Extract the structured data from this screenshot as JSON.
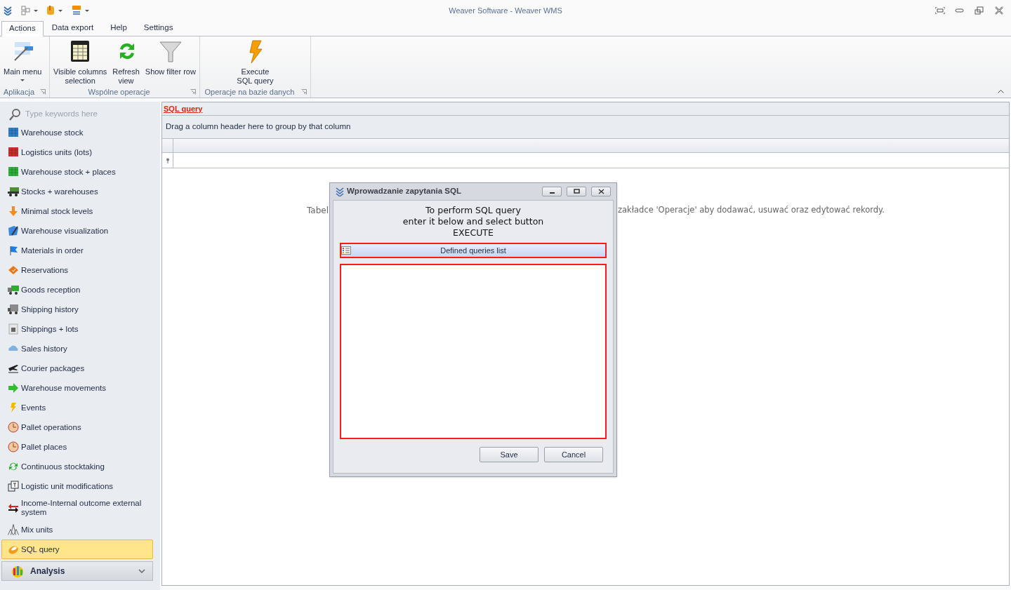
{
  "window": {
    "title": "Weaver Software - Weaver WMS"
  },
  "tabs": [
    {
      "label": "Actions",
      "selected": true
    },
    {
      "label": "Data export",
      "selected": false
    },
    {
      "label": "Help",
      "selected": false
    },
    {
      "label": "Settings",
      "selected": false
    }
  ],
  "ribbon": {
    "groups": [
      {
        "caption": "Aplikacja",
        "buttons": [
          {
            "label": "Main menu",
            "dropdown": true
          }
        ]
      },
      {
        "caption": "Wspólne operacje",
        "buttons": [
          {
            "label": "Visible columns\nselection",
            "dropdown": false
          },
          {
            "label": "Refresh\nview",
            "dropdown": false
          },
          {
            "label": "Show filter row",
            "dropdown": false
          }
        ]
      },
      {
        "caption": "Operacje na bazie danych",
        "buttons": [
          {
            "label": "Execute\nSQL query",
            "dropdown": false
          }
        ]
      }
    ]
  },
  "sidebar": {
    "search": {
      "placeholder": "Type keywords here"
    },
    "items": [
      {
        "label": "Warehouse stock",
        "selected": false
      },
      {
        "label": "Logistics units (lots)",
        "selected": false
      },
      {
        "label": "Warehouse stock + places",
        "selected": false
      },
      {
        "label": "Stocks + warehouses",
        "selected": false
      },
      {
        "label": "Minimal stock levels",
        "selected": false
      },
      {
        "label": "Warehouse visualization",
        "selected": false
      },
      {
        "label": "Materials in order",
        "selected": false
      },
      {
        "label": "Reservations",
        "selected": false
      },
      {
        "label": "Goods reception",
        "selected": false
      },
      {
        "label": "Shipping history",
        "selected": false
      },
      {
        "label": "Shippings + lots",
        "selected": false
      },
      {
        "label": "Sales history",
        "selected": false
      },
      {
        "label": "Courier packages",
        "selected": false
      },
      {
        "label": "Warehouse movements",
        "selected": false
      },
      {
        "label": "Events",
        "selected": false
      },
      {
        "label": "Pallet operations",
        "selected": false
      },
      {
        "label": "Pallet places",
        "selected": false
      },
      {
        "label": "Continuous stocktaking",
        "selected": false
      },
      {
        "label": "Logistic unit modifications",
        "selected": false
      },
      {
        "label": "Income-Internal outcome external system",
        "selected": false
      },
      {
        "label": "Mix units",
        "selected": false
      },
      {
        "label": "SQL query",
        "selected": true
      }
    ],
    "group": {
      "label": "Analysis",
      "expanded": false
    }
  },
  "main": {
    "heading": "SQL query",
    "group_panel": "Drag a column header here to group by that column",
    "empty_message_parts": [
      "Tabel",
      "zakładce 'Operacje' aby dodawać, usuwać oraz edytować rekordy."
    ]
  },
  "dialog": {
    "title": "Wprowadzanie zapytania SQL",
    "message": "To perform SQL query\nenter it below and select button\nEXECUTE",
    "list_button": "Defined queries list",
    "buttons": [
      "Save",
      "Cancel"
    ]
  }
}
